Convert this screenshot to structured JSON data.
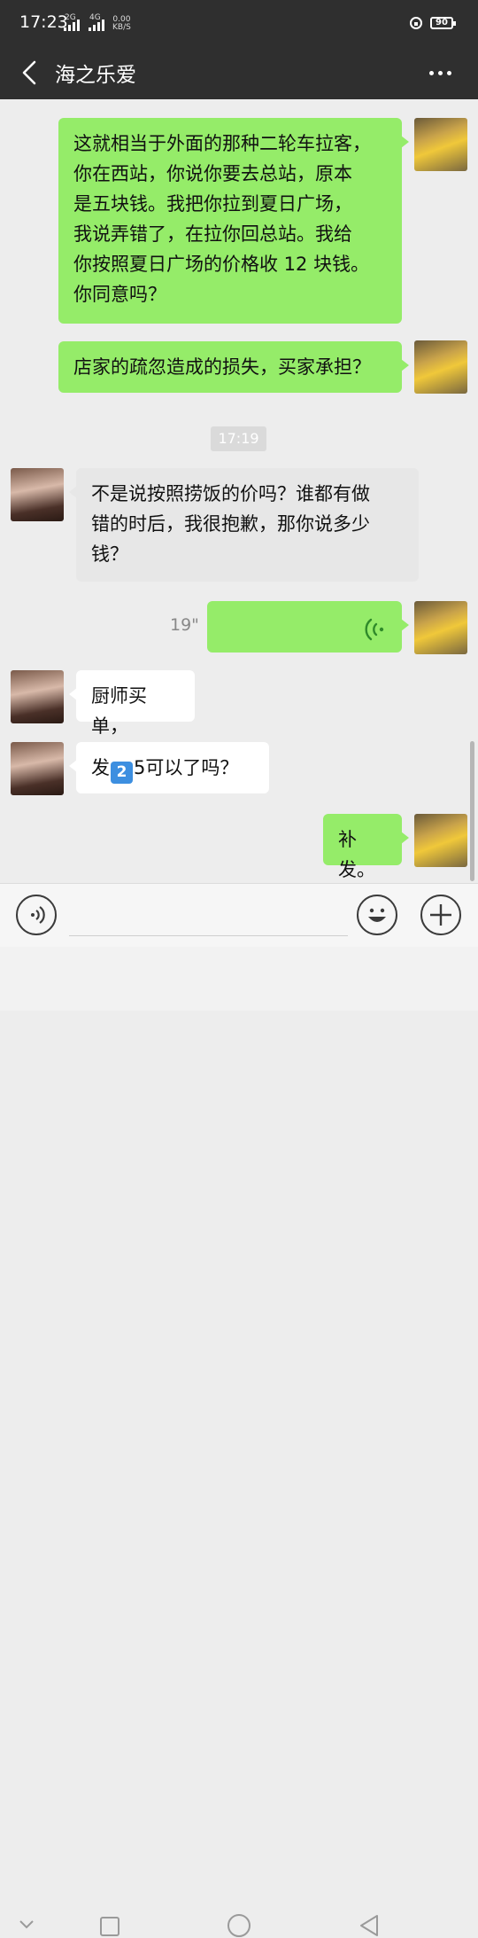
{
  "status_bar": {
    "time": "17:23",
    "signal1_label": "2G",
    "signal2_label": "4G",
    "net_speed_value": "0.00",
    "net_speed_unit": "KB/S",
    "battery": "90"
  },
  "header": {
    "title": "海之乐爱"
  },
  "messages": [
    {
      "sender": "self",
      "type": "text",
      "text": "这就相当于外面的那种二轮车拉客，\n你在西站，你说你要去总站，原本\n是五块钱。我把你拉到夏日广场，\n我说弄错了，在拉你回总站。我给\n你按照夏日广场的价格收 12 块钱。\n你同意吗？"
    },
    {
      "sender": "self",
      "type": "text",
      "text": "店家的疏忽造成的损失，买家承担？"
    },
    {
      "type": "time",
      "text": "17:19"
    },
    {
      "sender": "other",
      "type": "text",
      "text": "不是说按照捞饭的价吗？谁都有做\n错的时后，我很抱歉，那你说多少\n钱？"
    },
    {
      "sender": "self",
      "type": "voice",
      "duration": "19\""
    },
    {
      "sender": "other",
      "type": "text",
      "text": "厨师买单，"
    },
    {
      "sender": "other",
      "type": "text",
      "text_before": "发",
      "emoji": "2",
      "text_after": "5可以了吗？"
    },
    {
      "sender": "self",
      "type": "text",
      "text": "补发。"
    }
  ],
  "input_bar": {
    "placeholder": ""
  },
  "colors": {
    "header_bg": "#2f2f2f",
    "chat_bg": "#ededed",
    "self_bubble": "#95ec69",
    "other_bubble": "#ffffff"
  }
}
